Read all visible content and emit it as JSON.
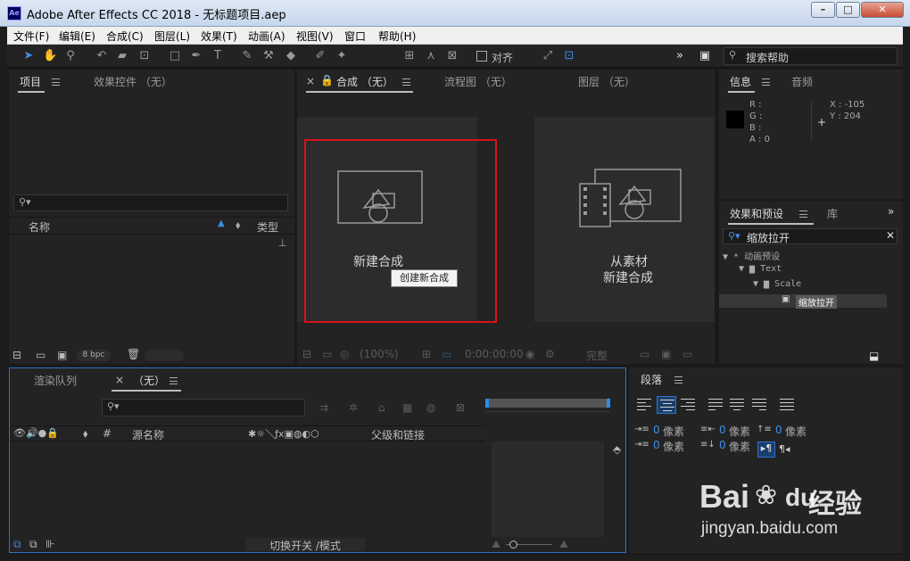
{
  "window": {
    "app_icon_label": "Ae",
    "title": "Adobe After Effects CC 2018 - 无标题项目.aep"
  },
  "menu": [
    "文件(F)",
    "编辑(E)",
    "合成(C)",
    "图层(L)",
    "效果(T)",
    "动画(A)",
    "视图(V)",
    "窗口",
    "帮助(H)"
  ],
  "toolbar": {
    "align_label": "对齐",
    "help_placeholder": "搜索帮助"
  },
  "project_panel": {
    "tab_project": "项目",
    "tab_effect_controls": "效果控件 （无）",
    "col_name": "名称",
    "col_type": "类型",
    "bpc_label": "8 bpc"
  },
  "comp_panel": {
    "tab_comp": "合成 （无）",
    "tab_flowchart": "流程图 （无）",
    "tab_layer": "图层 （无）",
    "new_comp_label": "新建合成",
    "tooltip": "创建新合成",
    "from_footage_line1": "从素材",
    "from_footage_line2": "新建合成",
    "zoom_label": "(100%)",
    "timecode": "0:00:00:00",
    "quality_label": "完整"
  },
  "info_panel": {
    "tab_info": "信息",
    "tab_audio": "音频",
    "r_label": "R :",
    "g_label": "G :",
    "b_label": "B :",
    "a_label": "A : 0",
    "x_label": "X : -105",
    "y_label": "Y : 204"
  },
  "effects_panel": {
    "tab_effects": "效果和预设",
    "tab_library": "库",
    "search_value": "缩放拉开",
    "tree": [
      "▼ * 动画预设",
      "▼ ▆ Text",
      "▼ ▆ Scale",
      "缩放拉开"
    ]
  },
  "timeline_panel": {
    "tab_render": "渲染队列",
    "tab_none": "（无）",
    "col_source_name": "源名称",
    "col_parent": "父级和链接",
    "col_hash": "#",
    "toggle_label": "切换开关 /模式"
  },
  "paragraph_panel": {
    "tab_label": "段落",
    "indent_value": "0",
    "unit": "像素"
  },
  "watermark": {
    "brand": "Bai",
    "brand_tail": "du",
    "brand_cn": "经验",
    "url": "jingyan.baidu.com"
  },
  "colors": {
    "highlight_box": "#d9121f",
    "accent_blue": "#2d8ceb"
  }
}
